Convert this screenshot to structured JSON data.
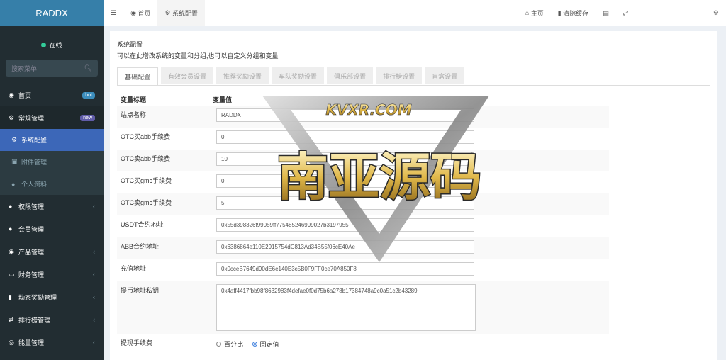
{
  "brand": "RADDX",
  "user": {
    "status": "在线"
  },
  "search": {
    "placeholder": "搜索菜单"
  },
  "menu": [
    {
      "label": "首页",
      "badge": "hot",
      "icon": "dashboard-icon"
    },
    {
      "label": "常规管理",
      "badge": "new",
      "icon": "cogs-icon"
    }
  ],
  "submenu": [
    {
      "label": "系统配置",
      "icon": "gear-icon"
    },
    {
      "label": "附件管理",
      "icon": "file-image-icon"
    },
    {
      "label": "个人资料",
      "icon": "user-icon"
    }
  ],
  "menu2": [
    {
      "label": "权限管理",
      "icon": "users-icon"
    },
    {
      "label": "会员管理",
      "icon": "user-icon"
    },
    {
      "label": "产品管理",
      "icon": "product-icon"
    },
    {
      "label": "财务管理",
      "icon": "credit-card-icon"
    },
    {
      "label": "动态奖励管理",
      "icon": "trash-icon"
    },
    {
      "label": "排行榜管理",
      "icon": "random-icon"
    },
    {
      "label": "能量管理",
      "icon": "circle-icon"
    }
  ],
  "topbar": {
    "tabs": [
      "首页",
      "系统配置"
    ],
    "right": [
      "主页",
      "清除缓存"
    ]
  },
  "panel": {
    "title": "系统配置",
    "subtitle": "可以在此增改系统的变量和分组,也可以自定义分组和变量"
  },
  "tabs": [
    "基础配置",
    "有效会员设置",
    "推荐奖励设置",
    "车队奖励设置",
    "俱乐部设置",
    "排行榜设置",
    "盲盒设置"
  ],
  "table": {
    "header": [
      "变量标题",
      "变量值"
    ],
    "rows": [
      {
        "label": "站点名称",
        "value": "RADDX"
      },
      {
        "label": "OTC买abb手续费",
        "value": "0"
      },
      {
        "label": "OTC卖abb手续费",
        "value": "10"
      },
      {
        "label": "OTC买gmc手续费",
        "value": "0"
      },
      {
        "label": "OTC卖gmc手续费",
        "value": "5"
      },
      {
        "label": "USDT合约地址",
        "value": "0x55d398326f99059ff775485246999027b3197955"
      },
      {
        "label": "ABB合约地址",
        "value": "0x6386864e110E2915754dC813Ad34B55f06cE40Ae"
      },
      {
        "label": "充值地址",
        "value": "0x0cceB7649d90dE6e140E3c5B0F9FF0ce70A850F8"
      }
    ],
    "textarea_row": {
      "label": "提币地址私钥",
      "value": "0x4aff4417fbb98f8632983f4defae0f0d75b6a278b17384748a9c0a51c2b43289"
    },
    "radio_row": {
      "label": "提现手续费",
      "options": [
        "百分比",
        "固定值"
      ],
      "selected": 1
    }
  },
  "watermark": {
    "line1": "KVXR.COM",
    "line2": "南亚源码"
  }
}
